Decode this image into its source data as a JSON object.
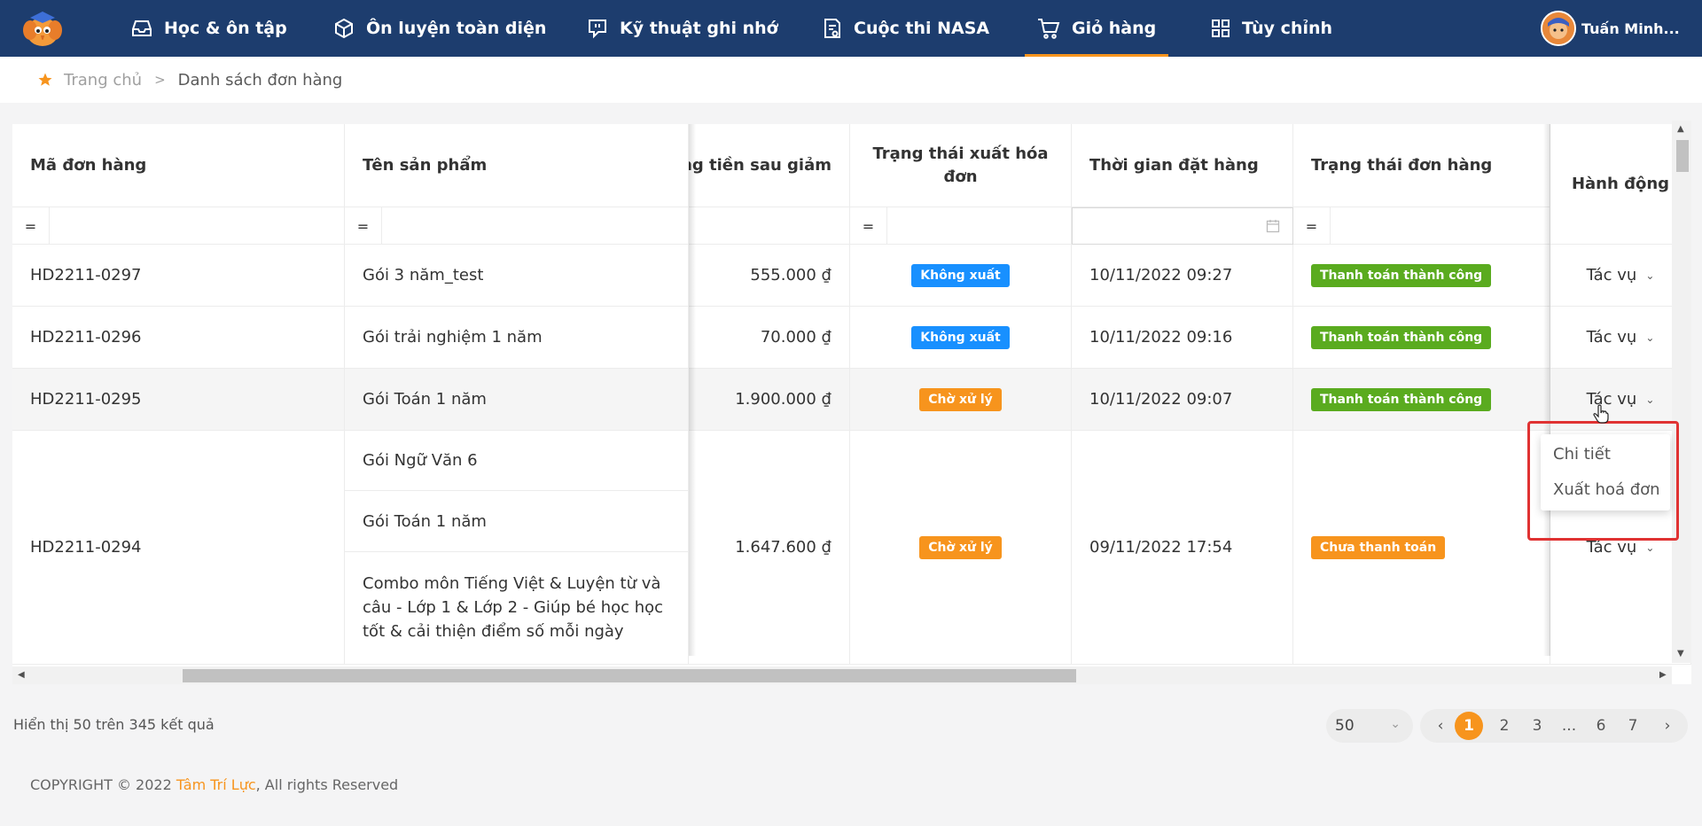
{
  "nav": {
    "items": [
      {
        "label": "Học & ôn tập",
        "icon": "inbox-icon"
      },
      {
        "label": "Ôn luyện toàn diện",
        "icon": "box-icon"
      },
      {
        "label": "Kỹ thuật ghi nhớ",
        "icon": "chat-bubble-icon"
      },
      {
        "label": "Cuộc thi NASA",
        "icon": "document-icon"
      },
      {
        "label": "Giỏ hàng",
        "icon": "cart-icon",
        "active": true
      },
      {
        "label": "Tùy chỉnh",
        "icon": "grid-icon"
      }
    ],
    "user_name": "Tuấn Minh..."
  },
  "breadcrumb": {
    "home": "Trang chủ",
    "separator": ">",
    "current": "Danh sách đơn hàng"
  },
  "table": {
    "columns": [
      "Mã đơn hàng",
      "Tên sản phẩm",
      "ổng tiền sau giảm",
      "Trạng thái xuất hóa đơn",
      "Thời gian đặt hàng",
      "Trạng thái đơn hàng",
      "Hành động"
    ],
    "filter_operator": "=",
    "rows": [
      {
        "code": "HD2211-0297",
        "products": [
          "Gói 3 năm_test"
        ],
        "total": "555.000 ₫",
        "invoice_status": "Không xuất",
        "time": "10/11/2022 09:27",
        "order_status": "Thanh toán thành công",
        "action": "Tác vụ"
      },
      {
        "code": "HD2211-0296",
        "products": [
          "Gói trải nghiệm 1 năm"
        ],
        "total": "70.000 ₫",
        "invoice_status": "Không xuất",
        "time": "10/11/2022 09:16",
        "order_status": "Thanh toán thành công",
        "action": "Tác vụ"
      },
      {
        "code": "HD2211-0295",
        "products": [
          "Gói Toán 1 năm"
        ],
        "total": "1.900.000 ₫",
        "invoice_status": "Chờ xử lý",
        "time": "10/11/2022 09:07",
        "order_status": "Thanh toán thành công",
        "action": "Tác vụ"
      },
      {
        "code": "HD2211-0294",
        "products": [
          "Gói Ngữ Văn 6",
          "Gói Toán 1 năm",
          "Combo môn Tiếng Việt & Luyện từ và câu - Lớp 1 & Lớp 2 - Giúp bé học học tốt & cải thiện điểm số mỗi ngày"
        ],
        "total": "1.647.600 ₫",
        "invoice_status": "Chờ xử lý",
        "time": "09/11/2022 17:54",
        "order_status": "Chưa thanh toán",
        "action": "Tác vụ"
      }
    ]
  },
  "dropdown": {
    "items": [
      "Chi tiết",
      "Xuất hoá đơn"
    ]
  },
  "summary": "Hiển thị 50 trên 345 kết quả",
  "page_size": "50",
  "pagination": {
    "prev": "‹",
    "pages": [
      "1",
      "2",
      "3",
      "...",
      "6",
      "7"
    ],
    "next": "›",
    "current": "1"
  },
  "footer": {
    "prefix": "COPYRIGHT © 2022 ",
    "brand": "Tâm Trí Lực",
    "suffix": ", All rights Reserved"
  },
  "colors": {
    "nav": "#1d3d6e",
    "accent": "#f7941d",
    "blue": "#1890ff",
    "green": "#5aab1f",
    "highlight": "#e03232"
  }
}
